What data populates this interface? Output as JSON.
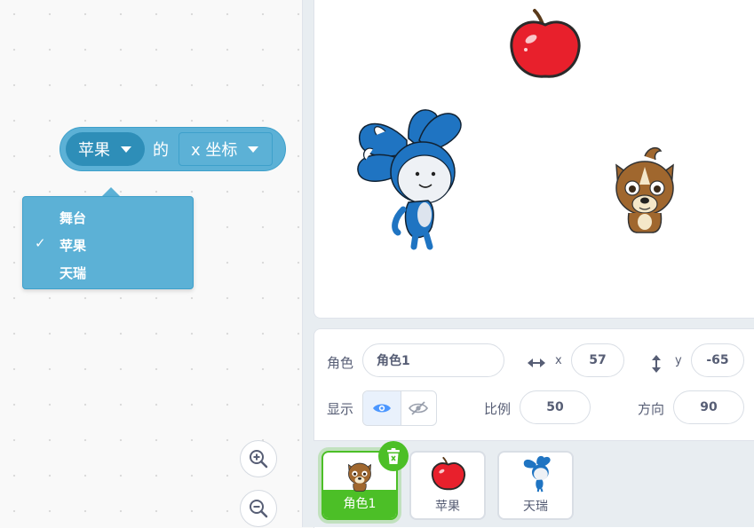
{
  "block": {
    "object_value": "苹果",
    "connector": "的",
    "property_value": "x 坐标"
  },
  "menu": {
    "items": [
      {
        "label": "舞台",
        "checked": false
      },
      {
        "label": "苹果",
        "checked": true
      },
      {
        "label": "天瑞",
        "checked": false
      }
    ],
    "check_mark": "✓"
  },
  "sprite_info": {
    "sprite_label": "角色",
    "sprite_name": "角色1",
    "x_label": "x",
    "x_value": "57",
    "y_label": "y",
    "y_value": "-65",
    "show_label": "显示",
    "size_label": "比例",
    "size_value": "50",
    "direction_label": "方向",
    "direction_value": "90"
  },
  "sprites": [
    {
      "name": "角色1",
      "selected": true
    },
    {
      "name": "苹果",
      "selected": false
    },
    {
      "name": "天瑞",
      "selected": false
    }
  ],
  "colors": {
    "block_blue": "#5cb1d6",
    "dropdown_dark": "#2e8eb8",
    "selected_green": "#4cbf27"
  }
}
